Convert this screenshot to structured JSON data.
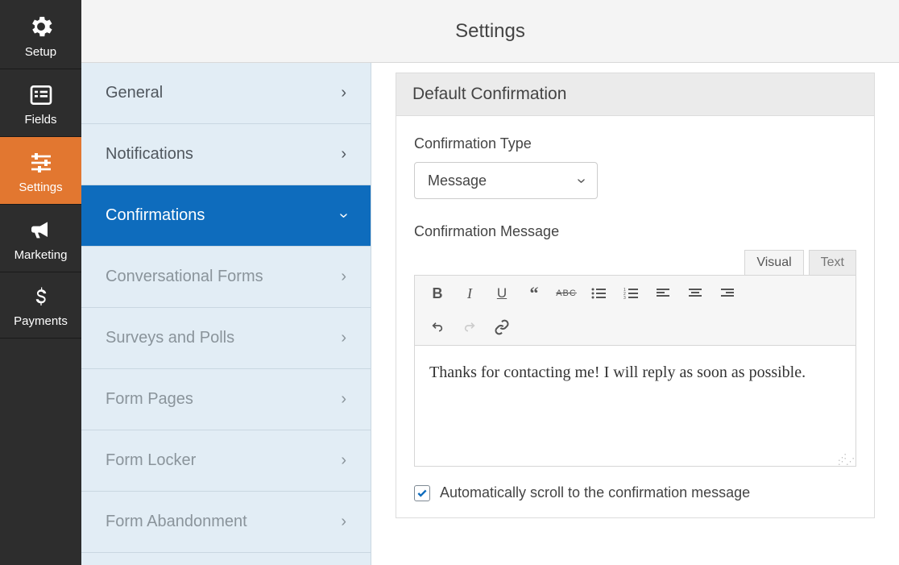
{
  "header": {
    "title": "Settings"
  },
  "nav": {
    "items": [
      {
        "label": "Setup",
        "icon": "gear-icon"
      },
      {
        "label": "Fields",
        "icon": "list-icon"
      },
      {
        "label": "Settings",
        "icon": "sliders-icon"
      },
      {
        "label": "Marketing",
        "icon": "bullhorn-icon"
      },
      {
        "label": "Payments",
        "icon": "dollar-icon"
      }
    ],
    "active_index": 2
  },
  "settings_sidebar": {
    "items": [
      {
        "label": "General"
      },
      {
        "label": "Notifications"
      },
      {
        "label": "Confirmations"
      },
      {
        "label": "Conversational Forms"
      },
      {
        "label": "Surveys and Polls"
      },
      {
        "label": "Form Pages"
      },
      {
        "label": "Form Locker"
      },
      {
        "label": "Form Abandonment"
      }
    ],
    "active_index": 2
  },
  "panel": {
    "title": "Default Confirmation",
    "type_label": "Confirmation Type",
    "type_value": "Message",
    "message_label": "Confirmation Message",
    "tabs": {
      "visual": "Visual",
      "text": "Text",
      "active": "visual"
    },
    "message_body": "Thanks for contacting me! I will reply as soon as possible.",
    "scroll_checkbox": {
      "checked": true,
      "label": "Automatically scroll to the confirmation message"
    }
  },
  "colors": {
    "orange": "#e27730",
    "blue": "#0e6cbd",
    "sidebar_bg": "#e2edf5"
  }
}
